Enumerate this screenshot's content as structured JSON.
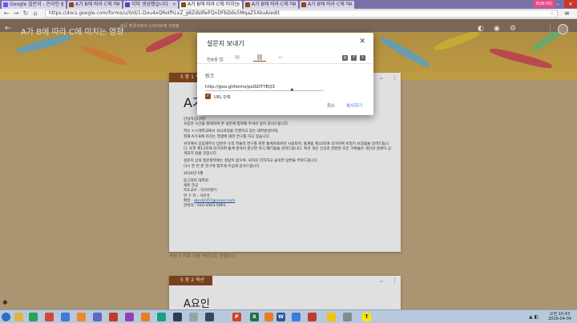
{
  "browser": {
    "tabs": [
      {
        "label": "Google 설문지 - 온라인 설...",
        "color": "#7c4dff",
        "active": false
      },
      {
        "label": "A가 B에 따라 C에 미치는...",
        "color": "#8a4a1e",
        "active": false
      },
      {
        "label": "이미 생성했습니다",
        "color": "#673ab7",
        "active": false
      },
      {
        "label": "A가 B에 따라 C에 미치는 영향",
        "color": "#8a4a1e",
        "active": true
      },
      {
        "label": "A가 B에 따라 C에 미치는...",
        "color": "#8a4a1e",
        "active": false
      },
      {
        "label": "A가 B에 따라 C에 미치는...",
        "color": "#8a4a1e",
        "active": false
      }
    ],
    "profile": "EUN HO",
    "url": "https://docs.google.com/forms/u/0/d/1-Dou4xQRoIfhLxZ_g6ZdsIReFQnDFbDdu5MqaZ5XkuA/edit"
  },
  "form_header": {
    "title": "A가 B에 따라 C에 미치는 영향",
    "saved_text": "모든 변경사항이 드라이브에 저장됨"
  },
  "card": {
    "section_label": "5 중 1 섹션",
    "title": "A가",
    "body": [
      "안녕하십니까?",
      "귀중한 시간을 할애하여 본 설문에 참여해 주셔서 깊이 감사드립니다.",
      "저는 ㅇㅇ대학교에서 석사과정을 진행하고 있는 대학원생이며,",
      "현재 A가 B에 미치는 영향에 대한 연구를 하고 있습니다.",
      "귀하께서 응답해주신 답변은 오직 학술적 연구를 위한 통계자료로만 사용되며, 통계법 제33조에 의거하여 비밀이 보장됨을 알려드립니다. 또한 제13조에 의거하여 통계 분석이 끝나면 즉시 폐기됨을 알려드립니다. 특히 개인 신상과 관련된 모든 기록물은 개인의 실명이 공개되지 않을 것입니다.",
      "설문지 상의 질문항목에는 정답이 없으며, 귀하의 진지하고 솔직한 답변을 부탁드립니다.",
      "다시 한 번 본 연구에 협조해 주심에 감사드립니다.",
      "2016년 5월",
      "동그라미 대학원",
      "세로 전공",
      "지도교수 : 다이아몬드",
      "연 구 자 : 사유각",
      "연락처 : 010-4563-5891"
    ],
    "email_label": "메일 : ",
    "email": "abcd2357@naver.com"
  },
  "section_footer": "섹션 1 이후   다음 섹션으로 진행하기",
  "card2": {
    "section_label": "5 중 2 섹션",
    "title": "A요인"
  },
  "dialog": {
    "title": "설문지 보내기",
    "send_via_label": "전송용 앱:",
    "link_heading": "링크",
    "link_url": "http://goo.gl/forms/psISDTYEQ3",
    "shorten_label": "URL 단축",
    "shorten_checked": true,
    "cancel_label": "취소",
    "copy_label": "복사하기"
  },
  "taskbar": {
    "time": "오전 10:43",
    "date": "2016-04-04"
  },
  "colors": {
    "accent": "#8a4a1e",
    "link_blue": "#3b78e7",
    "header": "#8a7560"
  }
}
